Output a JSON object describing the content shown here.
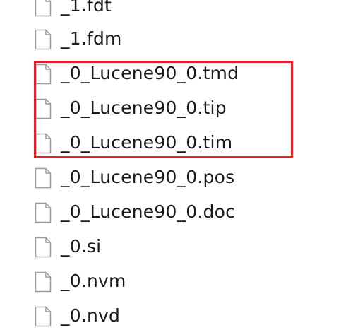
{
  "file_list": {
    "files": [
      {
        "name": "_1.fdt",
        "icon": "file-icon"
      },
      {
        "name": "_1.fdm",
        "icon": "file-icon"
      },
      {
        "name": "_0_Lucene90_0.tmd",
        "icon": "file-icon"
      },
      {
        "name": "_0_Lucene90_0.tip",
        "icon": "file-icon"
      },
      {
        "name": "_0_Lucene90_0.tim",
        "icon": "file-icon"
      },
      {
        "name": "_0_Lucene90_0.pos",
        "icon": "file-icon"
      },
      {
        "name": "_0_Lucene90_0.doc",
        "icon": "file-icon"
      },
      {
        "name": "_0.si",
        "icon": "file-icon"
      },
      {
        "name": "_0.nvm",
        "icon": "file-icon"
      },
      {
        "name": "_0.nvd",
        "icon": "file-icon"
      }
    ]
  },
  "highlight": {
    "color": "#e0232b"
  }
}
